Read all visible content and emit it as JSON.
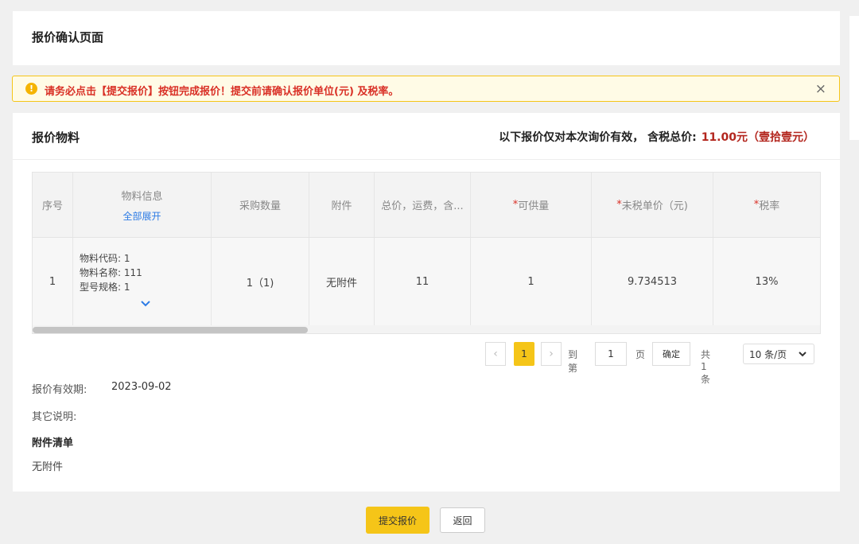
{
  "header": {
    "title": "报价确认页面"
  },
  "alert": {
    "icon": "exclamation-icon",
    "text": "请务必点击【提交报价】按钮完成报价！提交前请确认报价单位(元) 及税率。",
    "close": "×"
  },
  "materials": {
    "title": "报价物料",
    "total_prefix": "以下报价仅对本次询价有效， 含税总价:",
    "total_amount": "11.00元",
    "total_cn": "（壹拾壹元）"
  },
  "table": {
    "headers": {
      "index": "序号",
      "material": "物料信息",
      "expand_all": "全部展开",
      "qty": "采购数量",
      "attachment": "附件",
      "total": "总价，运费，含...",
      "supply_mark": "*",
      "supply": "可供量",
      "price_mark": "*",
      "price": "未税单价（元)",
      "tax_mark": "*",
      "tax": "税率"
    },
    "rows": [
      {
        "index": "1",
        "code": "物料代码: 1",
        "name": "物料名称: 111",
        "spec": "型号规格: 1",
        "qty": "1（1)",
        "attachment": "无附件",
        "total": "11",
        "supply": "1",
        "price": "9.734513",
        "tax": "13%"
      }
    ]
  },
  "pagination": {
    "prev": "‹",
    "current": "1",
    "next": "›",
    "goto_label": "到第",
    "goto_value": "1",
    "page_label": "页",
    "confirm": "确定",
    "total": "共 1 条",
    "page_size": "10 条/页"
  },
  "details": {
    "validity_label": "报价有效期:",
    "validity_value": "2023-09-02",
    "other_label": "其它说明:",
    "attachments_title": "附件清单",
    "attachments_value": "无附件"
  },
  "actions": {
    "submit": "提交报价",
    "back": "返回"
  }
}
